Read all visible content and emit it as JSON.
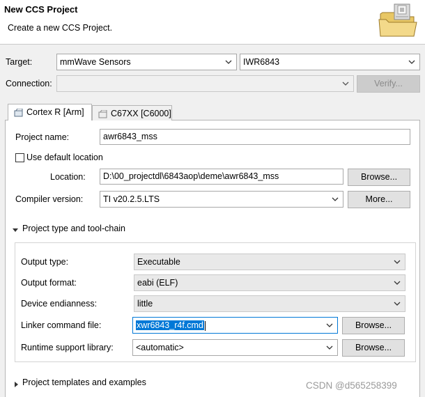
{
  "header": {
    "title": "New CCS Project",
    "subtitle": "Create a new CCS Project."
  },
  "target": {
    "label": "Target:",
    "family_value": "mmWave Sensors",
    "device_value": "IWR6843"
  },
  "connection": {
    "label": "Connection:",
    "value": "",
    "verify_label": "Verify..."
  },
  "tabs": [
    {
      "label": "Cortex R [Arm]",
      "active": true
    },
    {
      "label": "C67XX [C6000]",
      "active": false
    }
  ],
  "project": {
    "name_label": "Project name:",
    "name_value": "awr6843_mss",
    "default_location_label": "Use default location",
    "default_location_checked": false,
    "location_label": "Location:",
    "location_value": "D:\\00_projectdl\\6843aop\\deme\\awr6843_mss",
    "browse_label": "Browse...",
    "compiler_label": "Compiler version:",
    "compiler_value": "TI v20.2.5.LTS",
    "more_label": "More..."
  },
  "toolchain": {
    "section_label": "Project type and tool-chain",
    "output_type_label": "Output type:",
    "output_type_value": "Executable",
    "output_format_label": "Output format:",
    "output_format_value": "eabi (ELF)",
    "endianness_label": "Device endianness:",
    "endianness_value": "little",
    "linker_label": "Linker command file:",
    "linker_value": "xwr6843_r4f.cmd",
    "linker_browse_label": "Browse...",
    "runtime_label": "Runtime support library:",
    "runtime_value": "<automatic>",
    "runtime_browse_label": "Browse..."
  },
  "templates": {
    "section_label": "Project templates and examples"
  },
  "watermark": "CSDN @d565258399",
  "icons": {
    "folder": "folder-icon",
    "dropdown": "chevron-down-icon",
    "chip": "chip-icon",
    "expand": "triangle-icon"
  }
}
